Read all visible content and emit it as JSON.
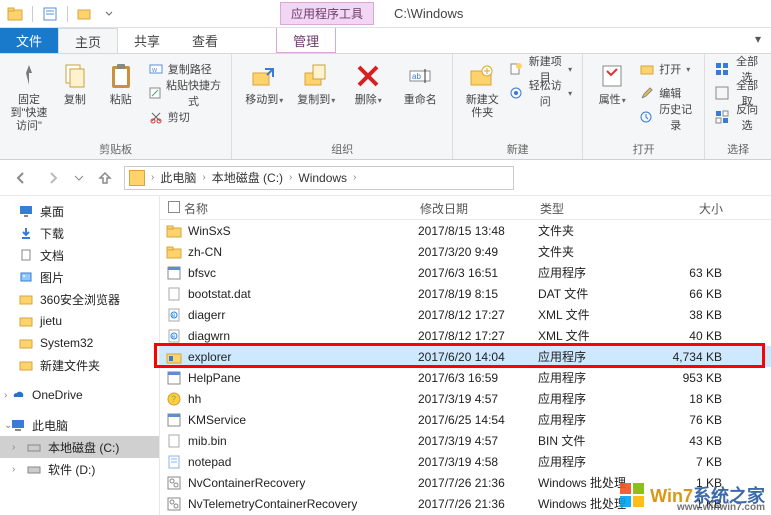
{
  "title_path": "C:\\Windows",
  "tool_tab": "应用程序工具",
  "tabs": {
    "file": "文件",
    "home": "主页",
    "share": "共享",
    "view": "查看",
    "manage": "管理"
  },
  "ribbon": {
    "pin": "固定到\"快速访问\"",
    "copy": "复制",
    "paste": "粘贴",
    "copy_path": "复制路径",
    "paste_shortcut": "粘贴快捷方式",
    "cut": "剪切",
    "group_clipboard": "剪贴板",
    "move_to": "移动到",
    "copy_to": "复制到",
    "delete": "删除",
    "rename": "重命名",
    "group_organize": "组织",
    "new_folder": "新建文件夹",
    "new_item": "新建项目",
    "easy_access": "轻松访问",
    "group_new": "新建",
    "properties": "属性",
    "open": "打开",
    "edit": "编辑",
    "history": "历史记录",
    "group_open": "打开",
    "select_all": "全部选",
    "select_none": "全部取",
    "invert": "反向选",
    "group_select": "选择"
  },
  "breadcrumb": [
    "此电脑",
    "本地磁盘 (C:)",
    "Windows"
  ],
  "nav": {
    "desktop": "桌面",
    "downloads": "下载",
    "documents": "文档",
    "pictures": "图片",
    "360": "360安全浏览器",
    "jietu": "jietu",
    "system32": "System32",
    "newfolder": "新建文件夹",
    "onedrive": "OneDrive",
    "thispc": "此电脑",
    "localc": "本地磁盘 (C:)",
    "locald": "软件 (D:)"
  },
  "columns": {
    "name": "名称",
    "date": "修改日期",
    "type": "类型",
    "size": "大小"
  },
  "files": [
    {
      "name": "WinSxS",
      "date": "2017/8/15 13:48",
      "type": "文件夹",
      "size": "",
      "icon": "folder"
    },
    {
      "name": "zh-CN",
      "date": "2017/3/20 9:49",
      "type": "文件夹",
      "size": "",
      "icon": "folder"
    },
    {
      "name": "bfsvc",
      "date": "2017/6/3 16:51",
      "type": "应用程序",
      "size": "63 KB",
      "icon": "exe"
    },
    {
      "name": "bootstat.dat",
      "date": "2017/8/19 8:15",
      "type": "DAT 文件",
      "size": "66 KB",
      "icon": "file"
    },
    {
      "name": "diagerr",
      "date": "2017/8/12 17:27",
      "type": "XML 文件",
      "size": "38 KB",
      "icon": "xml"
    },
    {
      "name": "diagwrn",
      "date": "2017/8/12 17:27",
      "type": "XML 文件",
      "size": "40 KB",
      "icon": "xml"
    },
    {
      "name": "explorer",
      "date": "2017/6/20 14:04",
      "type": "应用程序",
      "size": "4,734 KB",
      "icon": "explorer",
      "sel": true
    },
    {
      "name": "HelpPane",
      "date": "2017/6/3 16:59",
      "type": "应用程序",
      "size": "953 KB",
      "icon": "exe"
    },
    {
      "name": "hh",
      "date": "2017/3/19 4:57",
      "type": "应用程序",
      "size": "18 KB",
      "icon": "hh"
    },
    {
      "name": "KMService",
      "date": "2017/6/25 14:54",
      "type": "应用程序",
      "size": "76 KB",
      "icon": "exe"
    },
    {
      "name": "mib.bin",
      "date": "2017/3/19 4:57",
      "type": "BIN 文件",
      "size": "43 KB",
      "icon": "file"
    },
    {
      "name": "notepad",
      "date": "2017/3/19 4:58",
      "type": "应用程序",
      "size": "7 KB",
      "icon": "notepad"
    },
    {
      "name": "NvContainerRecovery",
      "date": "2017/7/26 21:36",
      "type": "Windows 批处理",
      "size": "1 KB",
      "icon": "bat"
    },
    {
      "name": "NvTelemetryContainerRecovery",
      "date": "2017/7/26 21:36",
      "type": "Windows 批处理",
      "size": "1 KB",
      "icon": "bat"
    }
  ],
  "watermark": {
    "main": "系统之家",
    "prefix": "Win7",
    "sub": "www.winwin7.com"
  },
  "highlight_row_index": 6
}
